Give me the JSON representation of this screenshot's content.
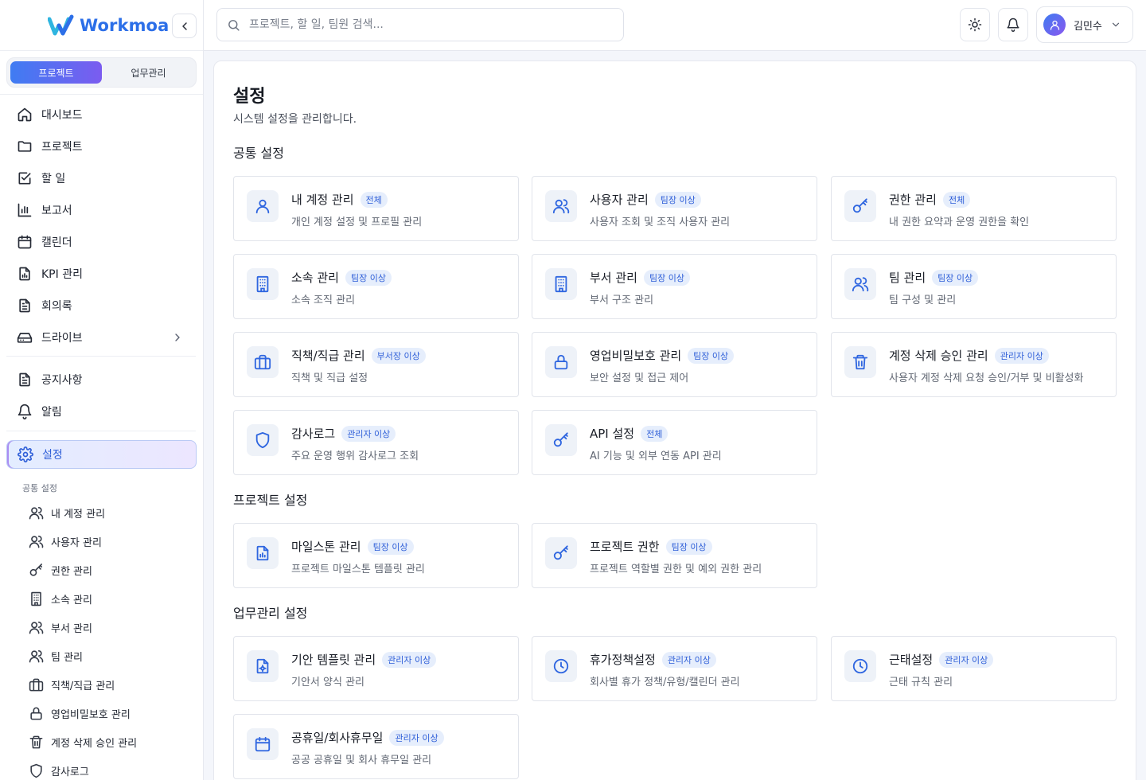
{
  "app": {
    "logo_text": "Workmoa"
  },
  "mode_switch": {
    "active": "프로젝트",
    "inactive": "업무관리"
  },
  "sidebar": {
    "main_items": [
      {
        "label": "대시보드",
        "icon": "home-icon"
      },
      {
        "label": "프로젝트",
        "icon": "folder-icon"
      },
      {
        "label": "할 일",
        "icon": "checkbox-icon"
      },
      {
        "label": "보고서",
        "icon": "bar-chart-icon"
      },
      {
        "label": "캘린더",
        "icon": "calendar-icon"
      },
      {
        "label": "KPI 관리",
        "icon": "file-chart-icon"
      },
      {
        "label": "회의록",
        "icon": "document-icon"
      },
      {
        "label": "드라이브",
        "icon": "drive-icon"
      }
    ],
    "secondary_items": [
      {
        "label": "공지사항",
        "icon": "document-icon"
      },
      {
        "label": "알림",
        "icon": "bell-icon"
      }
    ],
    "settings": {
      "label": "설정",
      "icon": "gear-icon"
    },
    "settings_group_title": "공통 설정",
    "settings_sub_items": [
      {
        "label": "내 계정 관리",
        "icon": "users-icon"
      },
      {
        "label": "사용자 관리",
        "icon": "users-icon"
      },
      {
        "label": "권한 관리",
        "icon": "key-icon"
      },
      {
        "label": "소속 관리",
        "icon": "building-icon"
      },
      {
        "label": "부서 관리",
        "icon": "users-icon"
      },
      {
        "label": "팀 관리",
        "icon": "users-icon"
      },
      {
        "label": "직책/직급 관리",
        "icon": "briefcase-icon"
      },
      {
        "label": "영업비밀보호 관리",
        "icon": "lock-icon"
      },
      {
        "label": "계정 삭제 승인 관리",
        "icon": "trash-icon"
      },
      {
        "label": "감사로그",
        "icon": "shield-icon"
      }
    ]
  },
  "topbar": {
    "search_placeholder": "프로젝트, 할 일, 팀원 검색...",
    "user_name": "김민수"
  },
  "page": {
    "title": "설정",
    "subtitle": "시스템 설정을 관리합니다."
  },
  "sections": [
    {
      "title": "공통 설정",
      "cards": [
        {
          "name": "내 계정 관리",
          "badge": "전체",
          "desc": "개인 계정 설정 및 프로필 관리",
          "icon": "user-icon"
        },
        {
          "name": "사용자 관리",
          "badge": "팀장 이상",
          "desc": "사용자 조회 및 조직 사용자 관리",
          "icon": "users-icon"
        },
        {
          "name": "권한 관리",
          "badge": "전체",
          "desc": "내 권한 요약과 운영 권한을 확인",
          "icon": "key-icon"
        },
        {
          "name": "소속 관리",
          "badge": "팀장 이상",
          "desc": "소속 조직 관리",
          "icon": "building-icon"
        },
        {
          "name": "부서 관리",
          "badge": "팀장 이상",
          "desc": "부서 구조 관리",
          "icon": "building-icon"
        },
        {
          "name": "팀 관리",
          "badge": "팀장 이상",
          "desc": "팀 구성 및 관리",
          "icon": "users-icon"
        },
        {
          "name": "직책/직급 관리",
          "badge": "부서장 이상",
          "desc": "직책 및 직급 설정",
          "icon": "briefcase-icon"
        },
        {
          "name": "영업비밀보호 관리",
          "badge": "팀장 이상",
          "desc": "보안 설정 및 접근 제어",
          "icon": "lock-icon"
        },
        {
          "name": "계정 삭제 승인 관리",
          "badge": "관리자 이상",
          "desc": "사용자 계정 삭제 요청 승인/거부 및 비활성화",
          "icon": "trash-icon"
        },
        {
          "name": "감사로그",
          "badge": "관리자 이상",
          "desc": "주요 운영 행위 감사로그 조회",
          "icon": "shield-icon"
        },
        {
          "name": "API 설정",
          "badge": "전체",
          "desc": "AI 기능 및 외부 연동 API 관리",
          "icon": "key-icon"
        }
      ]
    },
    {
      "title": "프로젝트 설정",
      "cards": [
        {
          "name": "마일스톤 관리",
          "badge": "팀장 이상",
          "desc": "프로젝트 마일스톤 템플릿 관리",
          "icon": "file-chart-icon"
        },
        {
          "name": "프로젝트 권한",
          "badge": "팀장 이상",
          "desc": "프로젝트 역할별 권한 및 예외 권한 관리",
          "icon": "key-icon"
        }
      ]
    },
    {
      "title": "업무관리 설정",
      "cards": [
        {
          "name": "기안 템플릿 관리",
          "badge": "관리자 이상",
          "desc": "기안서 양식 관리",
          "icon": "file-gear-icon"
        },
        {
          "name": "휴가정책설정",
          "badge": "관리자 이상",
          "desc": "회사별 휴가 정책/유형/캘린더 관리",
          "icon": "clock-icon"
        },
        {
          "name": "근태설정",
          "badge": "관리자 이상",
          "desc": "근태 규칙 관리",
          "icon": "clock-icon"
        },
        {
          "name": "공휴일/회사휴무일",
          "badge": "관리자 이상",
          "desc": "공공 공휴일 및 회사 휴무일 관리",
          "icon": "calendar-icon"
        }
      ]
    }
  ]
}
